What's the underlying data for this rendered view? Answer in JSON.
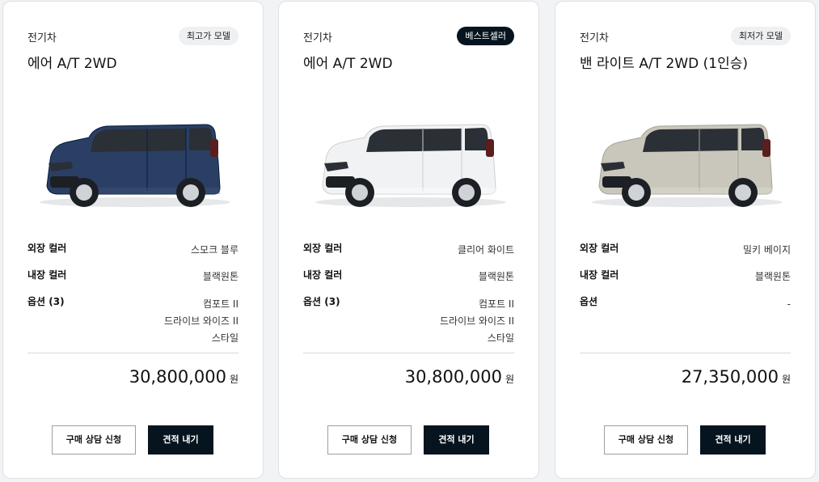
{
  "cards": [
    {
      "category": "전기차",
      "badge": "최고가 모델",
      "badge_style": "light",
      "model": "에어 A/T 2WD",
      "car_color": "#2a3f63",
      "specs": {
        "exterior_label": "외장 컬러",
        "exterior_value": "스모크 블루",
        "interior_label": "내장 컬러",
        "interior_value": "블랙원톤",
        "options_label": "옵션 (3)",
        "options": [
          "컴포트 II",
          "드라이브 와이즈 II",
          "스타일"
        ]
      },
      "price": "30,800,000",
      "price_unit": "원",
      "consult_label": "구매 상담 신청",
      "quote_label": "견적 내기"
    },
    {
      "category": "전기차",
      "badge": "베스트셀러",
      "badge_style": "dark",
      "model": "에어 A/T 2WD",
      "car_color": "#f1f2f3",
      "specs": {
        "exterior_label": "외장 컬러",
        "exterior_value": "클리어 화이트",
        "interior_label": "내장 컬러",
        "interior_value": "블랙원톤",
        "options_label": "옵션 (3)",
        "options": [
          "컴포트 II",
          "드라이브 와이즈 II",
          "스타일"
        ]
      },
      "price": "30,800,000",
      "price_unit": "원",
      "consult_label": "구매 상담 신청",
      "quote_label": "견적 내기"
    },
    {
      "category": "전기차",
      "badge": "최저가 모델",
      "badge_style": "light",
      "model": "밴 라이트 A/T 2WD (1인승)",
      "car_color": "#c9c7bb",
      "specs": {
        "exterior_label": "외장 컬러",
        "exterior_value": "밀키 베이지",
        "interior_label": "내장 컬러",
        "interior_value": "블랙원톤",
        "options_label": "옵션",
        "options": [
          "-"
        ]
      },
      "price": "27,350,000",
      "price_unit": "원",
      "consult_label": "구매 상담 신청",
      "quote_label": "견적 내기"
    }
  ],
  "colors": {
    "dark_button": "#05141f",
    "border": "#dcdfe4"
  }
}
